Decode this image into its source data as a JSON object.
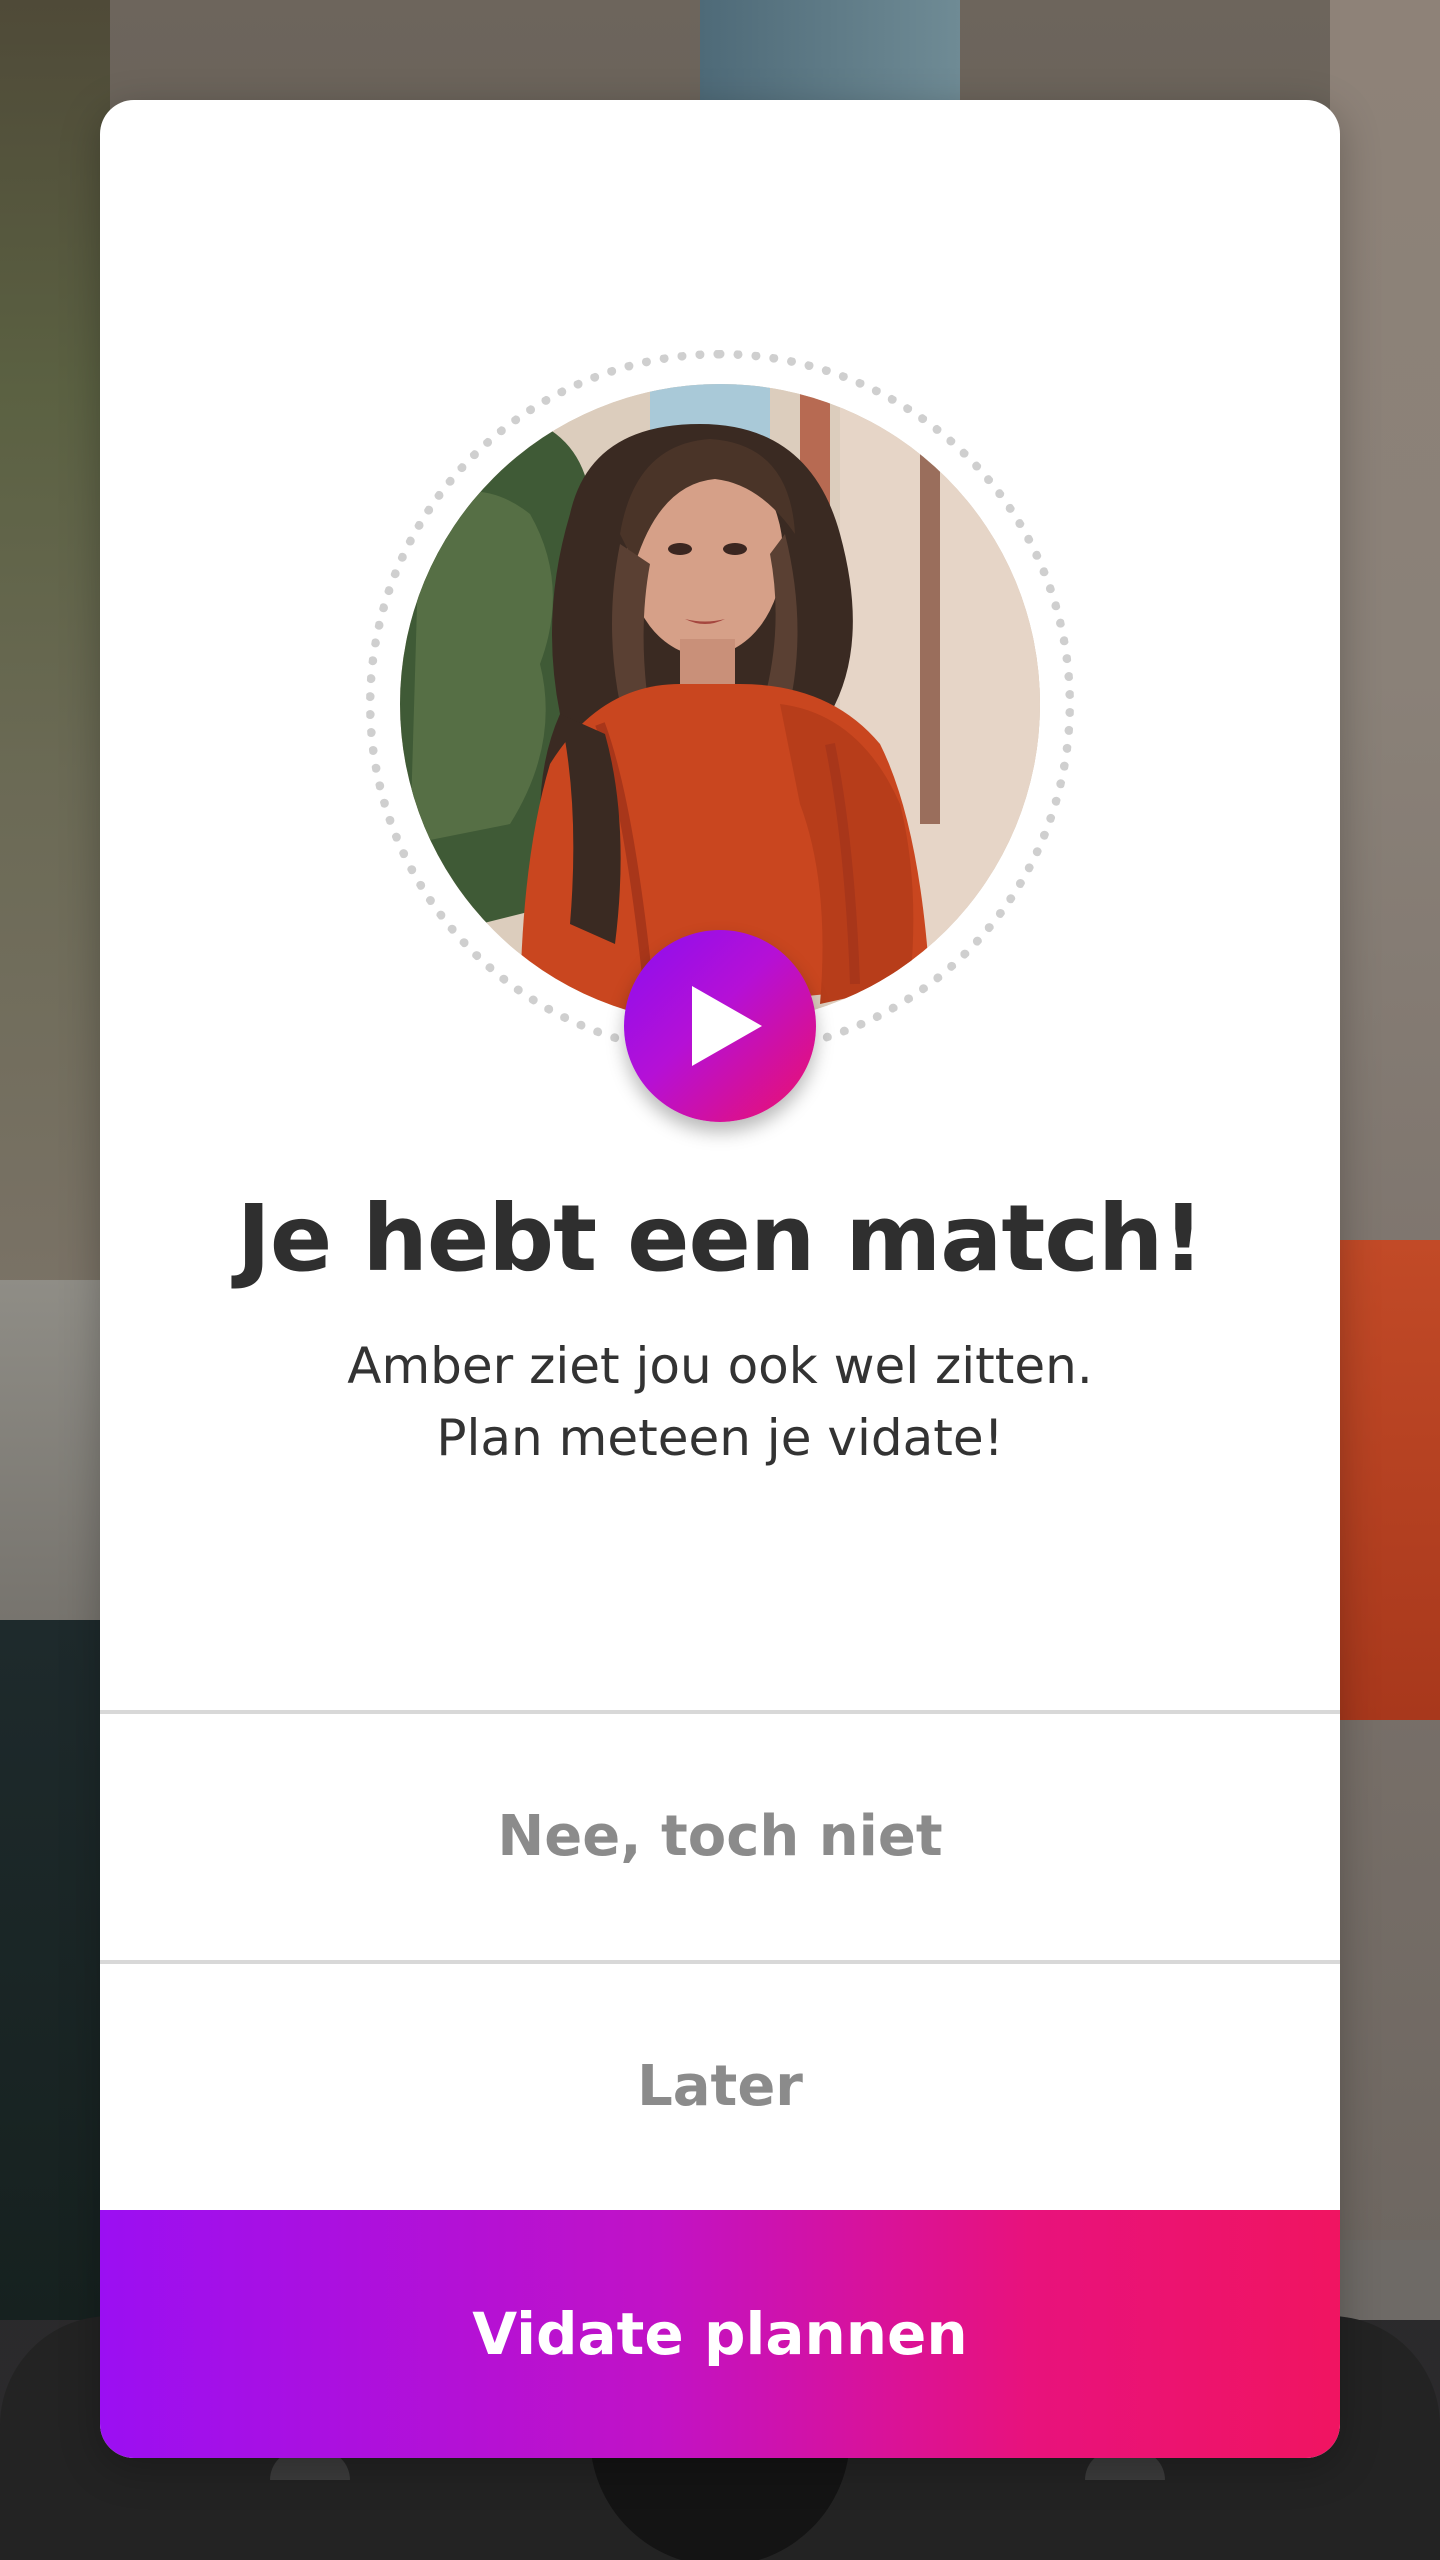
{
  "match_modal": {
    "title": "Je hebt een match!",
    "subtitle_line1": "Amber ziet jou ook wel zitten.",
    "subtitle_line2": "Plan meteen je vidate!",
    "decline_label": "Nee, toch niet",
    "later_label": "Later",
    "primary_label": "Vidate plannen"
  },
  "icons": {
    "play": "play-icon",
    "avatar": "profile-photo"
  },
  "colors": {
    "gradient_start": "#9b0ff2",
    "gradient_end": "#f01461",
    "title": "#2f2f2f",
    "secondary_text": "#8b8b8b",
    "divider": "#d8d8d8"
  }
}
